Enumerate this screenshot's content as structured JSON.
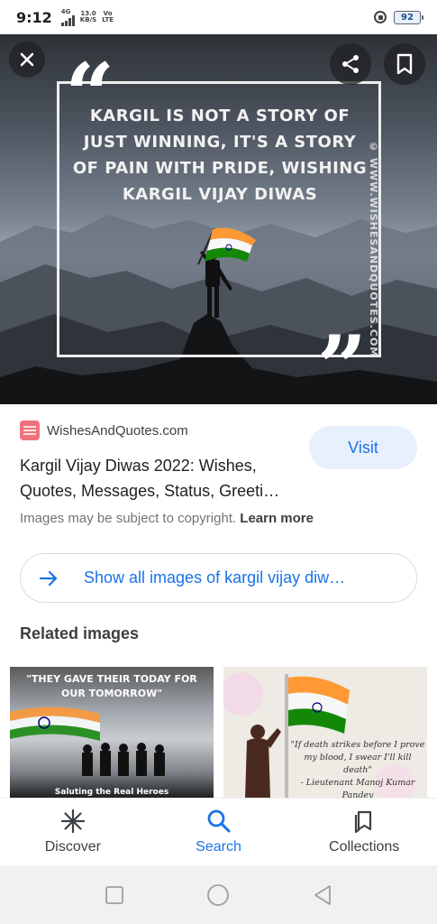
{
  "status_bar": {
    "time": "9:12",
    "network_type": "4G",
    "speed_value": "13.0",
    "speed_unit": "KB/S",
    "volte_top": "Vo",
    "volte_bottom": "LTE",
    "battery": "92"
  },
  "hero": {
    "quote_lines": [
      "KARGIL IS NOT A STORY OF",
      "JUST WINNING, IT'S A STORY",
      "OF PAIN WITH PRIDE, WISHING",
      "KARGIL VIJAY DIWAS"
    ],
    "open_quote": "“",
    "close_quote": "”",
    "watermark": "© WWW.WISHESANDQUOTES.COM",
    "icons": {
      "close": "close-icon",
      "share": "share-icon",
      "bookmark": "bookmark-icon"
    }
  },
  "result": {
    "source": "WishesAndQuotes.com",
    "visit_label": "Visit",
    "title": "Kargil Vijay Diwas 2022: Wishes, Quotes, Messages, Status, Greeti…",
    "copyright_text": "Images may be subject to copyright.",
    "learn_more": "Learn more",
    "show_all": "Show all images of kargil vijay diw…"
  },
  "related": {
    "heading": "Related images",
    "thumbs": [
      {
        "text": "\"THEY GAVE THEIR TODAY FOR OUR TOMORROW\"",
        "caption": "Saluting the Real Heroes"
      },
      {
        "quote": "\"If death strikes before I prove my blood, I swear I'll kill death\"",
        "attribution": "- Lieutenant Manoj Kumar Pandey"
      }
    ]
  },
  "bottom_nav": [
    {
      "label": "Discover",
      "icon": "asterisk-icon",
      "active": false
    },
    {
      "label": "Search",
      "icon": "search-icon",
      "active": true
    },
    {
      "label": "Collections",
      "icon": "collections-icon",
      "active": false
    }
  ],
  "colors": {
    "accent": "#1a73e8",
    "visit_bg": "#e8f0fe",
    "favicon": "#f1727a",
    "saffron": "#ff9933",
    "flag_green": "#138808"
  }
}
